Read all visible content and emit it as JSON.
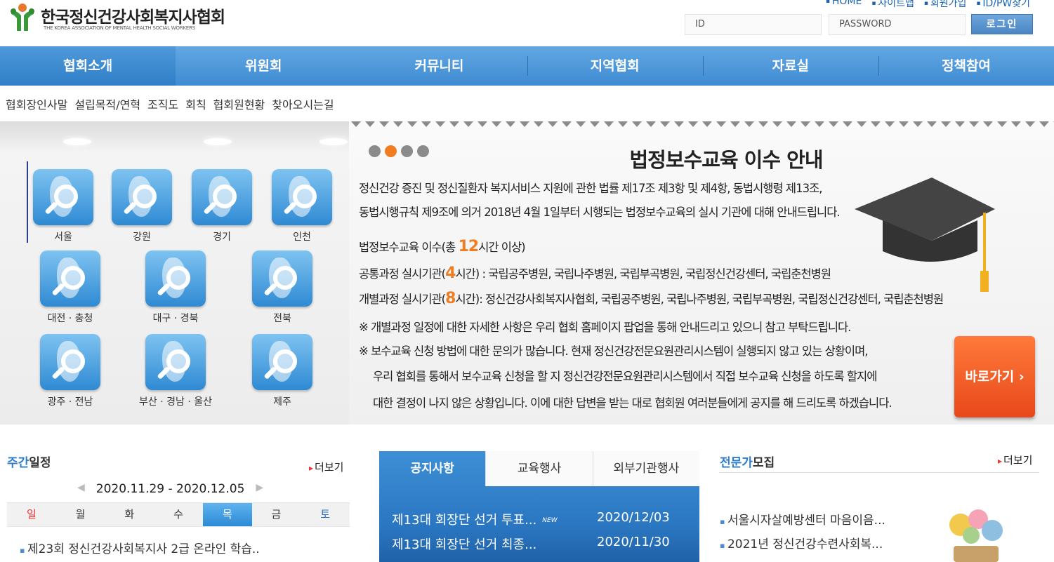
{
  "header": {
    "logo_title": "한국정신건강사회복지사협회",
    "logo_subtitle": "THE KOREA ASSOCIATION OF MENTAL HEALTH SOCIAL WORKERS",
    "util_links": [
      "HOME",
      "사이트맵",
      "회원가입",
      "ID/PW찾기"
    ],
    "login": {
      "id_placeholder": "ID",
      "pw_placeholder": "PASSWORD",
      "button": "로그인"
    }
  },
  "gnb": [
    "협회소개",
    "위원회",
    "커뮤니티",
    "지역협회",
    "자료실",
    "정책참여"
  ],
  "submenu": [
    "협회장인사말",
    "설립목적/연혁",
    "조직도",
    "회칙",
    "협회원현황",
    "찾아오시는길"
  ],
  "regions": [
    "서울",
    "강원",
    "경기",
    "인천",
    "대전 · 충청",
    "대구 · 경북",
    "전북",
    "광주 · 전남",
    "부산 · 경남 · 울산",
    "제주"
  ],
  "notice_banner": {
    "title": "법정보수교육 이수 안내",
    "intro_1": "정신건강 증진 및 정신질환자 복지서비스 지원에 관한 법률 제17조 제3항 및 제4항, 동법시행령 제13조,",
    "intro_2": "동법시행규칙 제9조에 의거 2018년 4월 1일부터 시행되는 법정보수교육의 실시 기관에 대해 안내드립니다.",
    "total_pre": "법정보수교육 이수(총 ",
    "total_hours": "12",
    "total_post": "시간 이상)",
    "common_pre": "공통과정 실시기관(",
    "common_hours": "4",
    "common_post": "시간) : 국립공주병원, 국립나주병원, 국립부곡병원, 국립정신건강센터, 국립춘천병원",
    "indiv_pre": "개별과정 실시기관(",
    "indiv_hours": "8",
    "indiv_post": "시간): 정신건강사회복지사협회, 국립공주병원, 국립나주병원, 국립부곡병원, 국립정신건강센터, 국립춘천병원",
    "note_1": "※ 개별과정 일정에 대한 자세한 사항은 우리 협회 홈페이지 팝업을 통해 안내드리고 있으니 참고 부탁드립니다.",
    "note_2": "※ 보수교육 신청 방법에 대한 문의가 많습니다. 현재 정신건강전문요원관리시스템이 실행되지 않고 있는 상황이며,",
    "note_3": "우리 협회를 통해서 보수교육 신청을 할 지 정신건강전문요원관리시스템에서 직접 보수교육 신청을 하도록 할지에",
    "note_4": "대한 결정이 나지 않은 상황입니다. 이에 대한 답변을 받는 대로 협회원 여러분들에게 공지를 해 드리도록 하겠습니다.",
    "go_button": "바로가기 ›",
    "slide_count": 4,
    "active_slide": 2
  },
  "schedule": {
    "title_blue": "주간",
    "title_rest": "일정",
    "more": "더보기",
    "week": "2020.11.29  -  2020.12.05",
    "prev": "◀",
    "next": "▶",
    "days": [
      "일",
      "월",
      "화",
      "수",
      "목",
      "금",
      "토"
    ],
    "today_index": 4,
    "items": [
      "제23회 정신건강사회복지사 2급 온라인 학습.."
    ]
  },
  "board": {
    "tabs": [
      "공지사항",
      "교육행사",
      "외부기관행사"
    ],
    "active_tab": 0,
    "rows": [
      {
        "title": "제13대 회장단 선거 투표...",
        "new": "NEW",
        "date": "2020/12/03"
      },
      {
        "title": "제13대 회장단 선거 최종...",
        "date": "2020/11/30"
      }
    ]
  },
  "expert": {
    "title_blue": "전문가",
    "title_rest": "모집",
    "more": "더보기",
    "items": [
      "서울시자살예방센터 마음이음...",
      "2021년 정신건강수련사회복..."
    ]
  },
  "colors": {
    "gnb": "#3e8bd1",
    "accent_orange": "#f07d22",
    "title_blue": "#2d7ccb"
  }
}
